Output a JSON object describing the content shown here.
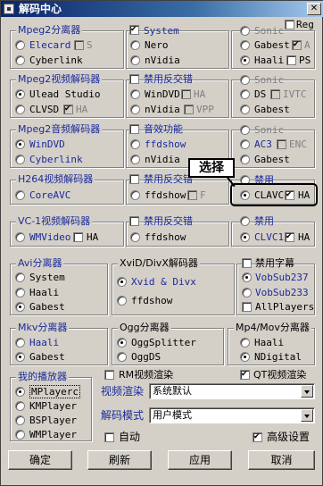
{
  "window": {
    "title": "解码中心"
  },
  "reg": "Reg",
  "mpeg2_splitter": {
    "title": "Mpeg2分离器",
    "elecard": "Elecard",
    "s": "S",
    "cyberlink": "Cyberlink",
    "system": "System",
    "nero": "Nero",
    "nvidia": "nVidia",
    "sonic": "Sonic",
    "gabest": "Gabest",
    "a": "A",
    "haali": "Haali",
    "ps": "PS"
  },
  "mpeg2_video": {
    "title": "Mpeg2视频解码器",
    "ulead": "Ulead Studio",
    "clvsd": "CLVSD",
    "ha": "HA",
    "disable": "禁用反交错",
    "windvd": "WinDVD",
    "ha2": "HA",
    "nvidia": "nVidia",
    "vpp": "VPP",
    "sonic": "Sonic",
    "ds": "DS",
    "ivtc": "IVTC",
    "gabest": "Gabest"
  },
  "mpeg2_audio": {
    "title": "Mpeg2音频解码器",
    "windvd": "WinDVD",
    "cyberlink": "Cyberlink",
    "no_func": "音效功能",
    "ffdshow": "ffdshow",
    "nvidia": "nVidia",
    "sonic": "Sonic",
    "ac3": "AC3",
    "enc": "ENC",
    "gabest": "Gabest"
  },
  "h264": {
    "title": "H264视频解码器",
    "coreavc": "CoreAVC",
    "disable": "禁用反交错",
    "ffdshow": "ffdshow",
    "f": "F",
    "disable2": "禁用",
    "clavc": "CLAVC",
    "ha": "HA"
  },
  "vc1": {
    "title": "VC-1视频解码器",
    "wmvideo": "WMVideo",
    "ha": "HA",
    "disable": "禁用反交错",
    "ffdshow": "ffdshow",
    "disable2": "禁用",
    "clvc1": "CLVC1",
    "ha2": "HA"
  },
  "avi": {
    "title": "Avi分离器",
    "system": "System",
    "haali": "Haali",
    "gabest": "Gabest"
  },
  "xvid": {
    "title": "XviD/DivX解码器",
    "xvid": "Xvid & Divx",
    "ffdshow": "ffdshow"
  },
  "subs": {
    "title": "禁用字幕",
    "vob237": "VobSub237",
    "vob233": "VobSub233",
    "allplayers": "AllPlayers"
  },
  "mkv": {
    "title": "Mkv分离器",
    "haali": "Haali",
    "gabest": "Gabest"
  },
  "ogg": {
    "title": "Ogg分离器",
    "splitter": "OggSplitter",
    "ds": "OggDS"
  },
  "mp4": {
    "title": "Mp4/Mov分离器",
    "haali": "Haali",
    "ndigital": "NDigital"
  },
  "players": {
    "title": "我的播放器",
    "mplayerc": "MPlayerc",
    "kmplayer": "KMPlayer",
    "bsplayer": "BSPlayer",
    "wmplayer": "WMPlayer"
  },
  "render": {
    "rm": "RM视频渲染",
    "qt": "QT视频渲染",
    "video_label": "视频渲染",
    "video_value": "系统默认",
    "decode_label": "解码模式",
    "decode_value": "用户模式",
    "auto": "自动",
    "advanced": "高级设置"
  },
  "buttons": {
    "ok": "确定",
    "refresh": "刷新",
    "apply": "应用",
    "cancel": "取消"
  },
  "callout": "选择"
}
